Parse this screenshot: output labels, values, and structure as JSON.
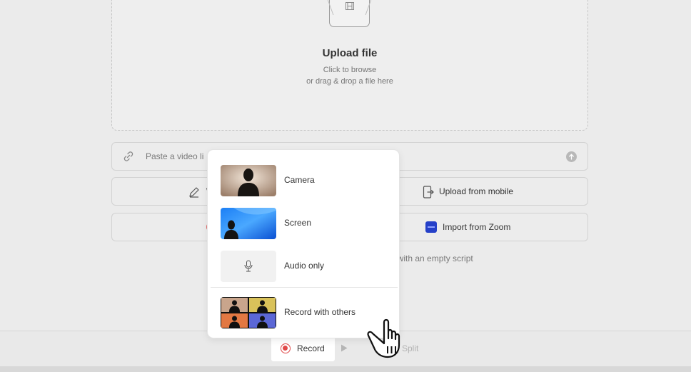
{
  "upload": {
    "title": "Upload file",
    "line1": "Click to browse",
    "line2": "or drag & drop a file here"
  },
  "link_input": {
    "placeholder": "Paste a video li"
  },
  "options": {
    "write_fragment": "W",
    "upload_mobile": "Upload from mobile",
    "import_zoom": "Import from Zoom"
  },
  "empty_hint": "ue with an empty script",
  "record_menu": {
    "items": [
      {
        "label": "Camera"
      },
      {
        "label": "Screen"
      },
      {
        "label": "Audio only"
      },
      {
        "label": "Record with others"
      }
    ]
  },
  "toolbar": {
    "record_label": "Record",
    "split_label": "Split"
  },
  "colors": {
    "record_red": "#e04848",
    "zoom_blue": "#2540c8"
  }
}
